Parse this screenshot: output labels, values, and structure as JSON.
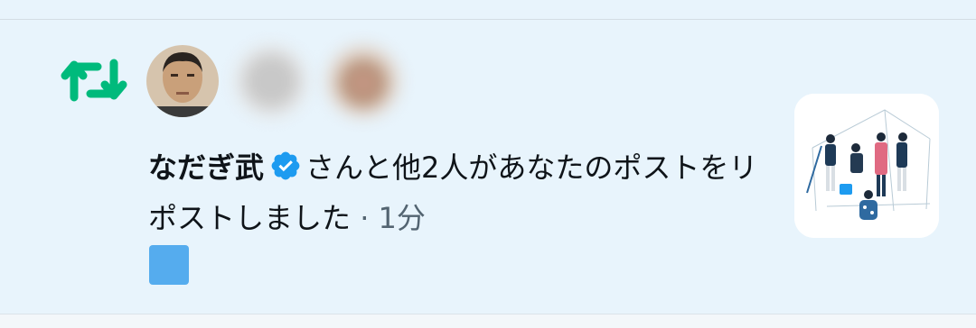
{
  "notification": {
    "actor_name": "なだぎ武",
    "action_text": "さんと他2人があなたのポストをリポストしました",
    "separator": " · ",
    "time_ago": "1分"
  },
  "colors": {
    "background": "#e8f4fc",
    "retweet_green": "#00ba7c",
    "verified_blue": "#1d9bf0",
    "text_primary": "#0f1419",
    "text_secondary": "#536471",
    "emoji_box": "#55acee"
  },
  "icons": {
    "repost": "repost-icon",
    "verified": "verified-badge-icon"
  }
}
